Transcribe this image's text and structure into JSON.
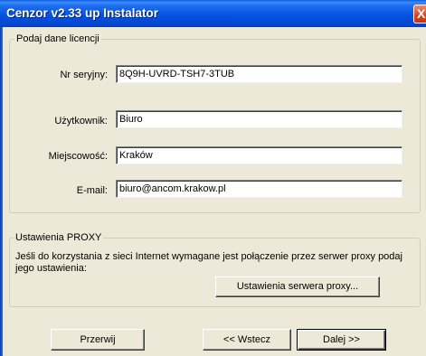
{
  "window": {
    "title": "Cenzor v2.33 up Instalator",
    "close_label": "X"
  },
  "license": {
    "legend": "Podaj dane licencji",
    "serial_label": "Nr seryjny:",
    "serial_value": "8Q9H-UVRD-TSH7-3TUB",
    "user_label": "Użytkownik:",
    "user_value": "Biuro",
    "city_label": "Miejscowość:",
    "city_value": "Kraków",
    "email_label": "E-mail:",
    "email_value": "biuro@ancom.krakow.pl"
  },
  "proxy": {
    "legend": "Ustawienia PROXY",
    "description": "Jeśli do korzystania z sieci Internet wymagane jest połączenie przez serwer proxy podaj jego ustawienia:",
    "button_label": "Ustawienia serwera proxy..."
  },
  "footer": {
    "cancel_label": "Przerwij",
    "back_label": "<< Wstecz",
    "next_label": "Dalej >>"
  }
}
